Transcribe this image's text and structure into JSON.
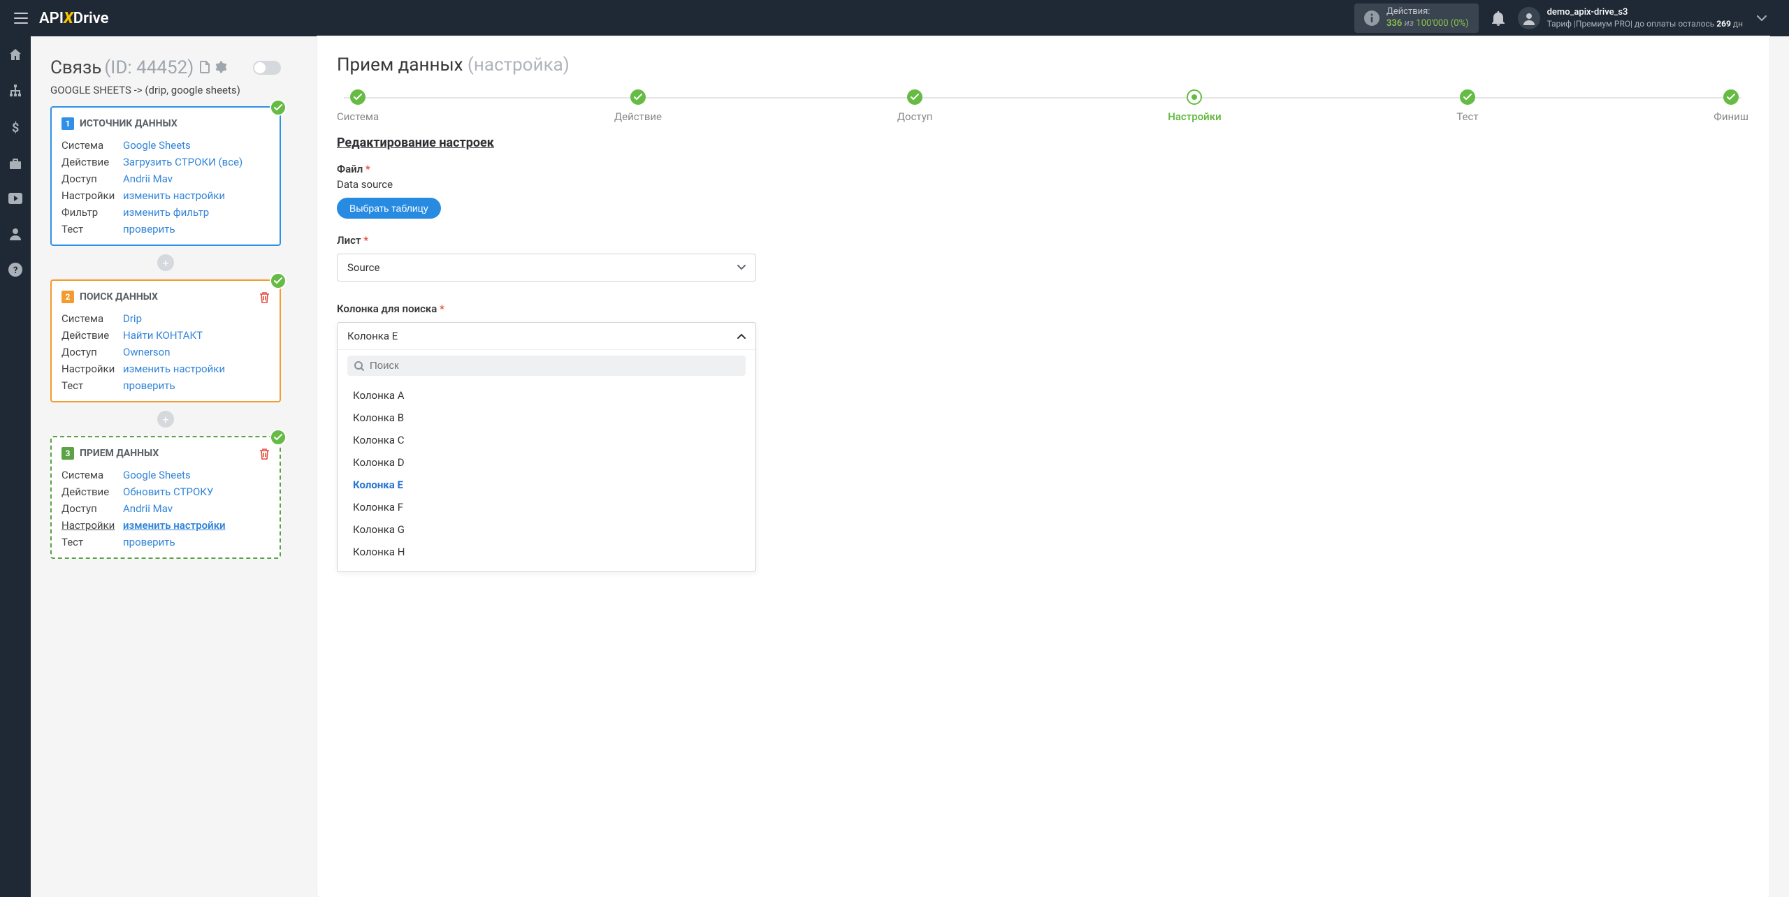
{
  "header": {
    "logo_prefix": "API",
    "logo_x": "X",
    "logo_suffix": "Drive",
    "actions_title": "Действия:",
    "actions_count": "336",
    "actions_of": "из",
    "actions_max": "100'000",
    "actions_pct": "(0%)",
    "user_name": "demo_apix-drive_s3",
    "user_plan_prefix": "Тариф |Премиум PRO| до оплаты осталось ",
    "user_plan_days": "269",
    "user_plan_suffix": " дн"
  },
  "link": {
    "title": "Связь",
    "id": "(ID: 44452)",
    "sub": "GOOGLE SHEETS -> (drip, google sheets)"
  },
  "cards": [
    {
      "badge": "1",
      "title": "ИСТОЧНИК ДАННЫХ",
      "rows": {
        "system_lbl": "Система",
        "system_val": "Google Sheets",
        "action_lbl": "Действие",
        "action_val": "Загрузить СТРОКИ (все)",
        "access_lbl": "Доступ",
        "access_val": "Andrii Mav",
        "settings_lbl": "Настройки",
        "settings_val": "изменить настройки",
        "filter_lbl": "Фильтр",
        "filter_val": "изменить фильтр",
        "test_lbl": "Тест",
        "test_val": "проверить"
      }
    },
    {
      "badge": "2",
      "title": "ПОИСК ДАННЫХ",
      "rows": {
        "system_lbl": "Система",
        "system_val": "Drip",
        "action_lbl": "Действие",
        "action_val": "Найти КОНТАКТ",
        "access_lbl": "Доступ",
        "access_val": "Ownerson",
        "settings_lbl": "Настройки",
        "settings_val": "изменить настройки",
        "test_lbl": "Тест",
        "test_val": "проверить"
      }
    },
    {
      "badge": "3",
      "title": "ПРИЕМ ДАННЫХ",
      "rows": {
        "system_lbl": "Система",
        "system_val": "Google Sheets",
        "action_lbl": "Действие",
        "action_val": "Обновить СТРОКУ",
        "access_lbl": "Доступ",
        "access_val": "Andrii Mav",
        "settings_lbl": "Настройки",
        "settings_val": "изменить настройки",
        "test_lbl": "Тест",
        "test_val": "проверить"
      }
    }
  ],
  "right": {
    "title": "Прием данных",
    "title_suffix": "(настройка)",
    "steps": {
      "system": "Система",
      "action": "Действие",
      "access": "Доступ",
      "settings": "Настройки",
      "test": "Тест",
      "finish": "Финиш"
    },
    "section_title": "Редактирование настроек",
    "file_label": "Файл",
    "file_value": "Data source",
    "select_table_btn": "Выбрать таблицу",
    "sheet_label": "Лист",
    "sheet_value": "Source",
    "search_col_label": "Колонка для поиска",
    "search_col_value": "Колонка E",
    "search_placeholder": "Поиск",
    "options": [
      "Колонка A",
      "Колонка B",
      "Колонка C",
      "Колонка D",
      "Колонка E",
      "Колонка F",
      "Колонка G",
      "Колонка H"
    ]
  }
}
